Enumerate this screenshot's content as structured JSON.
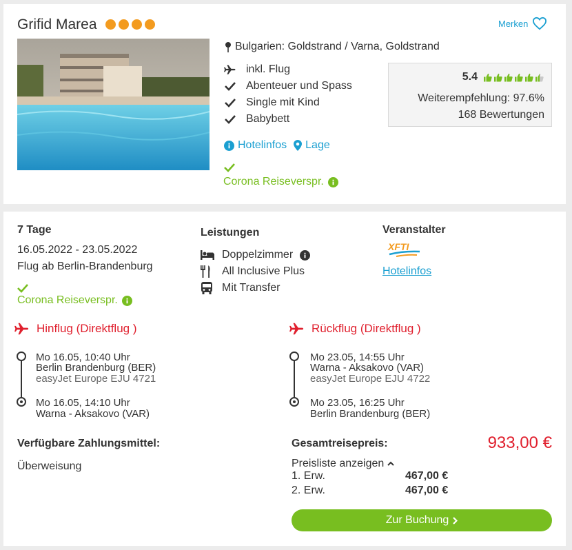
{
  "hotel": {
    "name": "Grifid Marea",
    "stars": 4,
    "merken_label": "Merken",
    "location": "Bulgarien: Goldstrand / Varna, Goldstrand",
    "features": [
      {
        "icon": "plane-icon",
        "label": "inkl. Flug"
      },
      {
        "icon": "check-icon",
        "label": "Abenteuer und Spass"
      },
      {
        "icon": "check-icon",
        "label": "Single mit Kind"
      },
      {
        "icon": "check-icon",
        "label": "Babybett"
      }
    ],
    "rating": {
      "score": "5.4",
      "thumbs_filled": 5.5,
      "thumbs_total": 6,
      "recommendation": "Weiterempfehlung: 97.6%",
      "reviews": "168 Bewertungen"
    },
    "links": {
      "hotelinfos": "Hotelinfos",
      "lage": "Lage"
    },
    "corona": "Corona Reiseverspr."
  },
  "offer": {
    "duration": "7 Tage",
    "dates": "16.05.2022 - 23.05.2022",
    "departure": "Flug ab Berlin-Brandenburg",
    "corona": "Corona Reiseverspr.",
    "services_title": "Leistungen",
    "services": [
      {
        "icon": "bed-icon",
        "label": "Doppelzimmer"
      },
      {
        "icon": "cutlery-icon",
        "label": "All Inclusive Plus"
      },
      {
        "icon": "bus-icon",
        "label": "Mit Transfer"
      }
    ],
    "operator_title": "Veranstalter",
    "operator_logo_text": "XFTI",
    "operator_link": "Hotelinfos"
  },
  "outbound": {
    "title": "Hinflug (Direktflug )",
    "dep_time": "Mo 16.05, 10:40 Uhr",
    "dep_airport": "Berlin Brandenburg (BER)",
    "carrier": "easyJet Europe EJU 4721",
    "arr_time": "Mo 16.05, 14:10 Uhr",
    "arr_airport": "Warna - Aksakovo (VAR)"
  },
  "return": {
    "title": "Rückflug (Direktflug )",
    "dep_time": "Mo 23.05, 14:55 Uhr",
    "dep_airport": "Warna - Aksakovo (VAR)",
    "carrier": "easyJet Europe EJU 4722",
    "arr_time": "Mo 23.05, 16:25 Uhr",
    "arr_airport": "Berlin Brandenburg (BER)"
  },
  "payment": {
    "title": "Verfügbare Zahlungsmittel:",
    "method": "Überweisung"
  },
  "price": {
    "title": "Gesamtreisepreis:",
    "total": "933,00 €",
    "list_toggle": "Preisliste anzeigen",
    "rows": [
      {
        "label": "1. Erw.",
        "value": "467,00 €"
      },
      {
        "label": "2. Erw.",
        "value": "467,00 €"
      }
    ],
    "book_label": "Zur Buchung"
  },
  "colors": {
    "accent_green": "#78be20",
    "link_blue": "#1a9fd1",
    "price_red": "#e0202e",
    "star_orange": "#f39b1f"
  }
}
